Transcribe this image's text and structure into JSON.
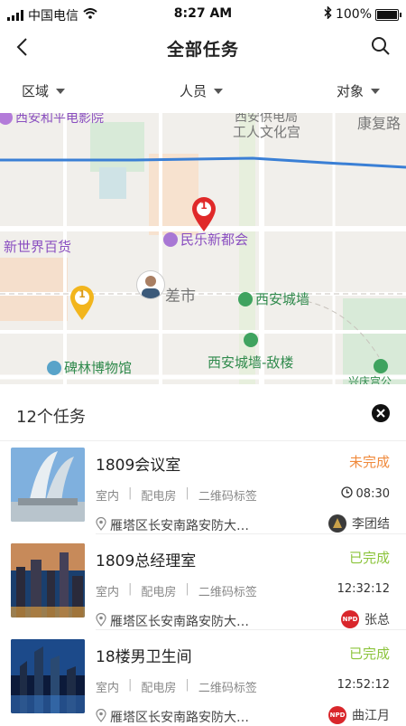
{
  "status": {
    "carrier": "中国电信",
    "time": "8:27 AM",
    "battery": "100%",
    "battery_level": 1.0
  },
  "nav": {
    "title": "全部任务",
    "back_icon": "back-arrow-icon",
    "search_icon": "search-icon"
  },
  "filters": [
    {
      "label": "区域"
    },
    {
      "label": "人员"
    },
    {
      "label": "对象"
    }
  ],
  "map": {
    "labels": {
      "peace_cinema": "西安和平电影院",
      "power_bureau_1": "西安供电局",
      "power_bureau_2": "工人文化宫",
      "kangfu": "康复路",
      "minle": "民乐新都会",
      "new_world": "新世界百货",
      "city_wall": "西安城墙",
      "city_wall_gate": "西安城墙-敌楼",
      "stele": "碑林博物馆",
      "cha_shi": "差市",
      "bottom_right": "兴庆宫公",
      "pin_red": "1",
      "pin_yellow": "1"
    },
    "colors": {
      "pin_red": "#e02929",
      "pin_yellow": "#f2b51d",
      "road_blue": "#3a7fd5"
    }
  },
  "sheet": {
    "count_label": "12个任务",
    "tasks": [
      {
        "title": "1809会议室",
        "status": "未完成",
        "status_color": "#f08a3c",
        "tags": [
          "室内",
          "配电房",
          "二维码标签"
        ],
        "time": "08:30",
        "address": "雁塔区长安南路安防大…",
        "user": "李团结"
      },
      {
        "title": "1809总经理室",
        "status": "已完成",
        "status_color": "#8cc43c",
        "tags": [
          "室内",
          "配电房",
          "二维码标签"
        ],
        "time": "12:32:12",
        "address": "雁塔区长安南路安防大…",
        "user": "张总"
      },
      {
        "title": "18楼男卫生间",
        "status": "已完成",
        "status_color": "#8cc43c",
        "tags": [
          "室内",
          "配电房",
          "二维码标签"
        ],
        "time": "12:52:12",
        "address": "雁塔区长安南路安防大…",
        "user": "曲江月"
      }
    ]
  }
}
